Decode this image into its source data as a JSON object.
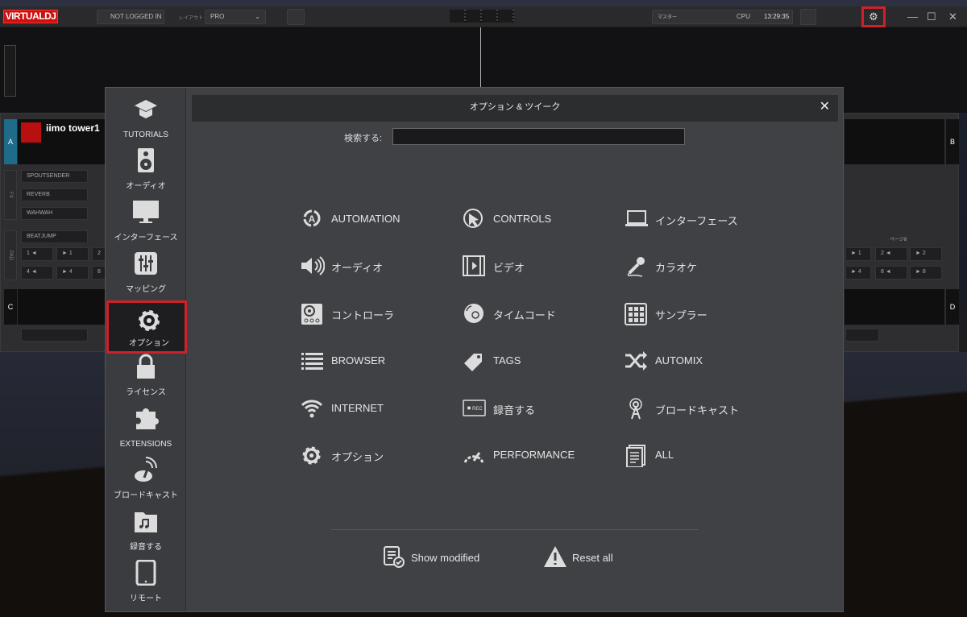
{
  "topbar": {
    "logo": "VIRTUALDJ",
    "login": "NOT LOGGED IN",
    "layout_label": "レイアウト",
    "layout_value": "PRO",
    "master_label": "マスター",
    "cpu_label": "CPU",
    "clock": "13:29:35",
    "settings_icon": "gear-icon"
  },
  "decks": {
    "a_label": "A",
    "b_label": "B",
    "c_label": "C",
    "d_label": "D",
    "track_title": "iimo tower1",
    "fx": [
      "SPOUTSENDER",
      "REVERB",
      "WAHWAH"
    ],
    "fx_side": "FX",
    "pad_mode": "BEATJUMP",
    "pad_side": "PAD",
    "page_label": "ページ8",
    "pads_left": [
      "1 ◄",
      "► 1",
      "2",
      "4 ◄",
      "► 4",
      "8"
    ],
    "pads_right": [
      "► 1",
      "2 ◄",
      "► 2",
      "► 4",
      "8 ◄",
      "► 8"
    ]
  },
  "dialog": {
    "title": "オプション & ツイーク",
    "search_label": "検索する:",
    "search_value": "",
    "sidebar": [
      {
        "label": "TUTORIALS",
        "icon": "graduation-cap-icon"
      },
      {
        "label": "オーディオ",
        "icon": "speaker-icon"
      },
      {
        "label": "インターフェース",
        "icon": "monitor-icon"
      },
      {
        "label": "マッピング",
        "icon": "sliders-icon"
      },
      {
        "label": "オプション",
        "icon": "gear-icon",
        "selected": true
      },
      {
        "label": "ライセンス",
        "icon": "lock-icon"
      },
      {
        "label": "EXTENSIONS",
        "icon": "puzzle-icon"
      },
      {
        "label": "ブロードキャスト",
        "icon": "broadcast-icon"
      },
      {
        "label": "録音する",
        "icon": "music-folder-icon"
      },
      {
        "label": "リモート",
        "icon": "tablet-icon"
      }
    ],
    "categories": [
      {
        "label": "AUTOMATION",
        "icon": "automation-icon"
      },
      {
        "label": "CONTROLS",
        "icon": "cursor-icon"
      },
      {
        "label": "インターフェース",
        "icon": "laptop-icon"
      },
      {
        "label": "オーディオ",
        "icon": "volume-icon"
      },
      {
        "label": "ビデオ",
        "icon": "film-icon"
      },
      {
        "label": "カラオケ",
        "icon": "microphone-icon"
      },
      {
        "label": "コントローラ",
        "icon": "turntable-icon"
      },
      {
        "label": "タイムコード",
        "icon": "disc-icon"
      },
      {
        "label": "サンプラー",
        "icon": "pad-grid-icon"
      },
      {
        "label": "BROWSER",
        "icon": "list-icon"
      },
      {
        "label": "TAGS",
        "icon": "tag-icon"
      },
      {
        "label": "AUTOMIX",
        "icon": "shuffle-icon"
      },
      {
        "label": "INTERNET",
        "icon": "wifi-icon"
      },
      {
        "label": "録音する",
        "icon": "rec-icon"
      },
      {
        "label": "ブロードキャスト",
        "icon": "antenna-icon"
      },
      {
        "label": "オプション",
        "icon": "gear-icon"
      },
      {
        "label": "PERFORMANCE",
        "icon": "gauge-icon"
      },
      {
        "label": "ALL",
        "icon": "documents-icon"
      }
    ],
    "footer": {
      "show_modified": "Show modified",
      "reset_all": "Reset all"
    }
  },
  "colors": {
    "highlight": "#d0202a",
    "deck_a": "#1e6b8a",
    "logo": "#cc1111"
  }
}
